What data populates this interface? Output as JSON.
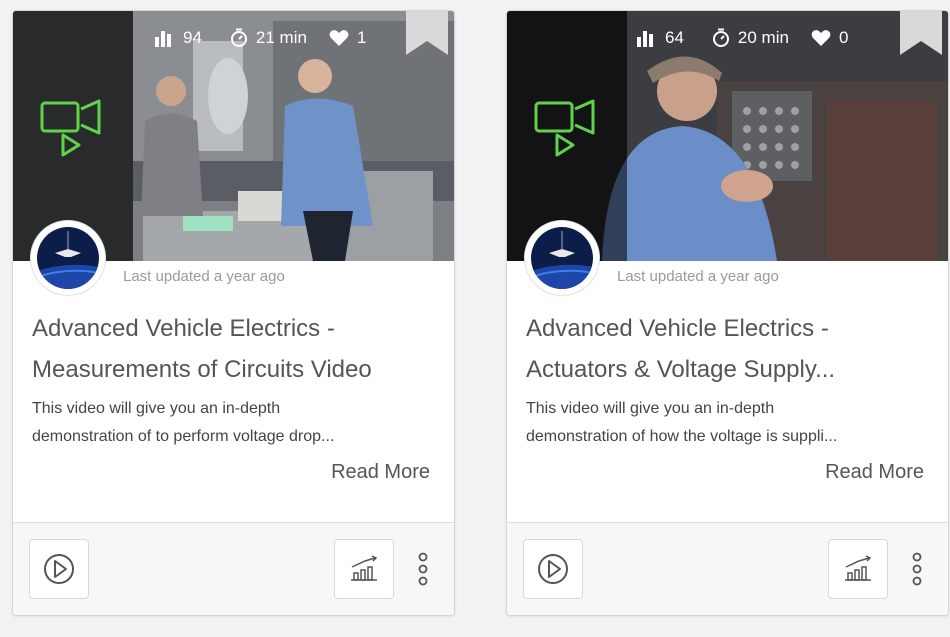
{
  "cards": [
    {
      "stats": {
        "level": "94",
        "duration": "21 min",
        "likes": "1"
      },
      "updated": "Last updated a year ago",
      "title_line1": "Advanced Vehicle Electrics -",
      "title_line2": "Measurements of Circuits Video",
      "desc_line1": "This video will give you an in-depth",
      "desc_line2": "demonstration of to perform voltage drop...",
      "read_more": "Read More",
      "icons": [
        "video-icon",
        "bar-chart-icon",
        "stopwatch-icon",
        "heart-icon",
        "bookmark-icon",
        "play-circle-icon",
        "progress-chart-icon",
        "more-vertical-icon"
      ]
    },
    {
      "stats": {
        "level": "64",
        "duration": "20 min",
        "likes": "0"
      },
      "updated": "Last updated a year ago",
      "title_line1": "Advanced Vehicle Electrics -",
      "title_line2": "Actuators & Voltage Supply...",
      "desc_line1": "This video will give you an in-depth",
      "desc_line2": "demonstration of how the voltage is suppli...",
      "read_more": "Read More",
      "icons": [
        "video-icon",
        "bar-chart-icon",
        "stopwatch-icon",
        "heart-icon",
        "bookmark-icon",
        "play-circle-icon",
        "progress-chart-icon",
        "more-vertical-icon"
      ]
    }
  ],
  "colors": {
    "accent_green": "#5fd34a",
    "title_text": "#555555",
    "muted_text": "#9a9a9a",
    "footer_bg": "#f7f7f7"
  }
}
